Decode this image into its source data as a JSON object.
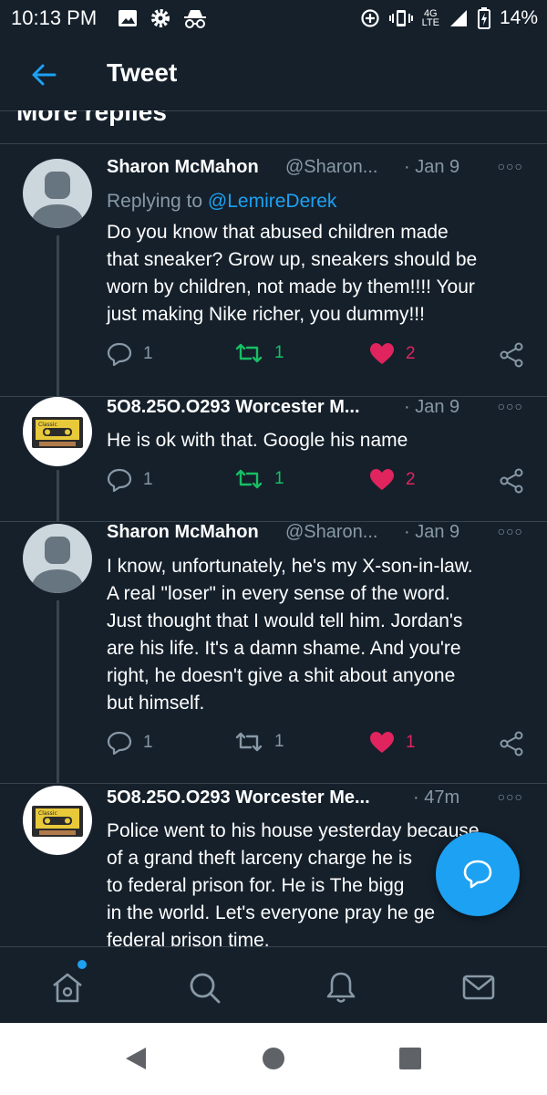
{
  "status_bar": {
    "time": "10:13 PM",
    "network": "4G",
    "network_sub": "LTE",
    "battery": "14%"
  },
  "header": {
    "title": "Tweet",
    "section_title": "More replies"
  },
  "tweets": [
    {
      "avatar": "default-avatar",
      "name": "Sharon McMahon",
      "handle": "@Sharon...",
      "date": "· Jan 9",
      "replying_label": "Replying to ",
      "replying_to": "@LemireDerek",
      "lines": [
        "Do you know that abused children made",
        "that sneaker? Grow up, sneakers should be",
        "worn by children, not made by them!!!! Your",
        "just making Nike richer, you dummy!!!"
      ],
      "replies": "1",
      "retweets": "1",
      "likes": "2"
    },
    {
      "avatar": "cassette-avatar",
      "name": "5O8.25O.O293 Worcester M...",
      "date": "· Jan 9",
      "lines": [
        "He is ok with that. Google his name"
      ],
      "replies": "1",
      "retweets": "1",
      "likes": "2"
    },
    {
      "avatar": "default-avatar",
      "name": "Sharon McMahon",
      "handle": "@Sharon...",
      "date": "· Jan 9",
      "lines": [
        "I know, unfortunately, he's my X-son-in-law.",
        "A real \"loser\" in every sense of the word.",
        "Just thought that I would tell him. Jordan's",
        "are his life. It's a damn shame. And you're",
        "right, he doesn't give a shit about anyone",
        "but himself."
      ],
      "replies": "1",
      "retweets": "1",
      "likes": "1"
    },
    {
      "avatar": "cassette-avatar",
      "name": "5O8.25O.O293 Worcester Me...",
      "date": "· 47m",
      "lines": [
        "Police went to his house yesterday because",
        "of a grand theft larceny charge he is",
        "to federal prison for. He is The bigg",
        "in the world. Let's everyone pray he ge",
        "federal prison time."
      ]
    }
  ],
  "colors": {
    "background": "#15202b",
    "accent": "#1da1f2",
    "muted": "#8899a6",
    "retweet_green": "#17bf63",
    "like_red": "#e0245e",
    "divider": "#38444d"
  }
}
